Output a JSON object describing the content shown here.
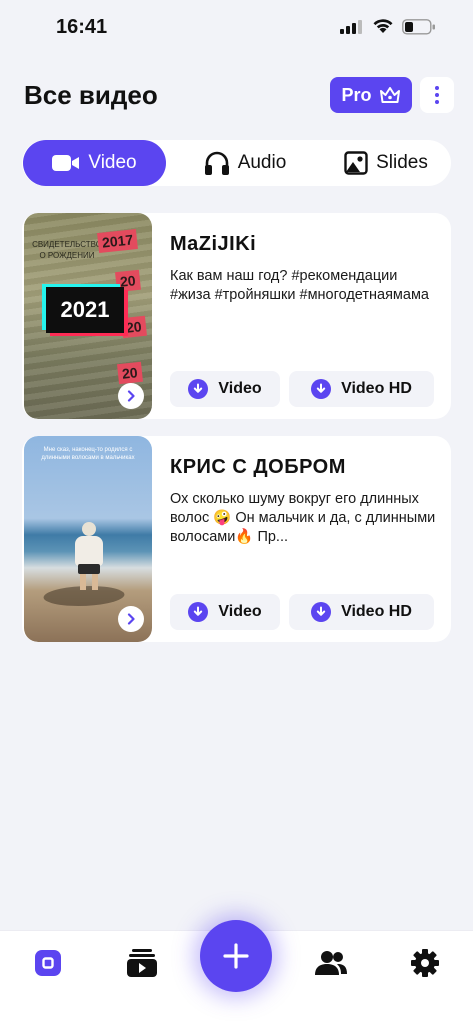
{
  "status_bar": {
    "time": "16:41"
  },
  "header": {
    "title": "Все видео",
    "pro_label": "Pro"
  },
  "tabs": [
    {
      "label": "Video",
      "icon": "video-camera-icon",
      "active": true
    },
    {
      "label": "Audio",
      "icon": "headphones-icon",
      "active": false
    },
    {
      "label": "Slides",
      "icon": "image-icon",
      "active": false
    }
  ],
  "cards": [
    {
      "title": "MaZiJIKi",
      "description": "Как вам наш год? #рекомендации #жиза #тройняшки #многодетнаямама",
      "thumbnail": {
        "badge": "2021",
        "doc_text": "СВИДЕТЕЛЬСТВО О РОЖДЕНИИ",
        "tag_2017": "2017",
        "tag_20a": "20",
        "tag_20b": "20",
        "tag_20c": "20"
      },
      "download_video": "Video",
      "download_hd": "Video HD"
    },
    {
      "title": "КРИС С ДОБРОМ",
      "description": "Ох сколько шуму вокруг его длинных волос 🤪 Он мальчик и да, с длинными волосами🔥 Пр...",
      "thumbnail": {
        "overlay_text": "Мне сказ, наконец-то родился с длинными волосами в мальчиках"
      },
      "download_video": "Video",
      "download_hd": "Video HD"
    }
  ],
  "colors": {
    "accent": "#5b45f0",
    "background": "#f2f3f8",
    "card": "#ffffff"
  },
  "bottom_nav": [
    "home-icon",
    "video-library-icon",
    "add-icon",
    "users-icon",
    "settings-icon"
  ]
}
